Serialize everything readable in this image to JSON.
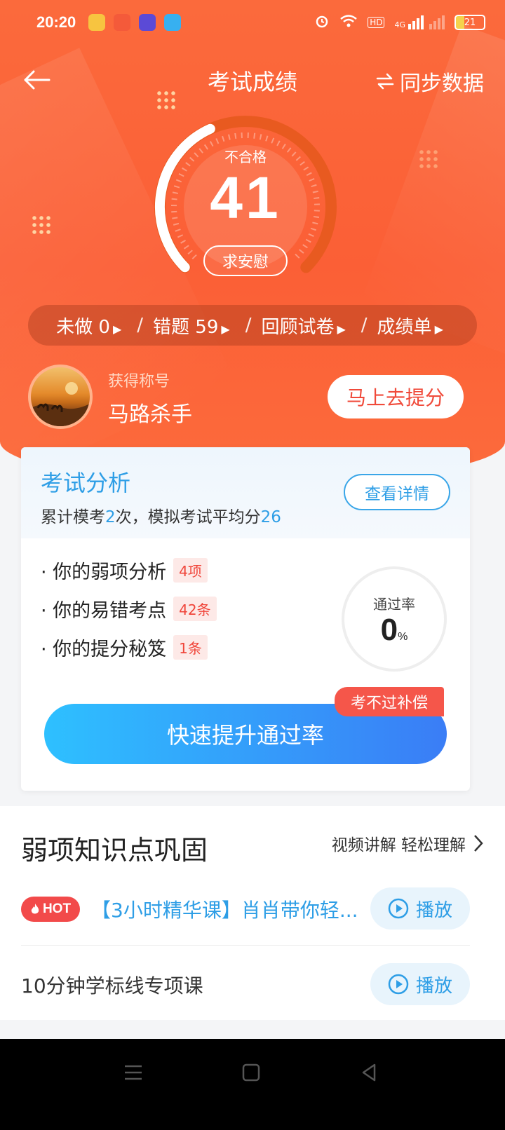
{
  "status_bar": {
    "time": "20:20",
    "battery": "21",
    "network": "4G",
    "hd_label": "HD",
    "app_icon_colors": [
      "#f7c440",
      "#f45a3a",
      "#5b4ad6",
      "#37b0f0"
    ]
  },
  "nav": {
    "title": "考试成绩",
    "sync_label": "同步数据"
  },
  "gauge": {
    "status": "不合格",
    "score": "41",
    "score_max": 100,
    "comfort_label": "求安慰"
  },
  "stats": {
    "undone": "未做 0",
    "wrong": "错题  59",
    "review": "回顾试卷",
    "report": "成绩单"
  },
  "profile": {
    "title_label": "获得称号",
    "title_value": "马路杀手",
    "boost_label": "马上去提分"
  },
  "analysis": {
    "title": "考试分析",
    "detail_label": "查看详情",
    "summary_prefix": "累计模考",
    "exam_count": "2",
    "summary_mid": "次，模拟考试平均分",
    "avg_score": "26",
    "items": [
      {
        "label": "· 你的弱项分析",
        "tag": "4项"
      },
      {
        "label": "· 你的易错考点",
        "tag": "42条"
      },
      {
        "label": "· 你的提分秘笈",
        "tag": "1条"
      }
    ],
    "pass_label": "通过率",
    "pass_value": "0",
    "pass_unit": "%",
    "fast_label": "快速提升通过率",
    "comp_tag": "考不过补偿"
  },
  "weak": {
    "title": "弱项知识点巩固",
    "more_label": "视频讲解 轻松理解",
    "courses": [
      {
        "hot": "HOT",
        "title": "【3小时精华课】肖肖带你轻...",
        "play": "播放"
      },
      {
        "title": "10分钟学标线专项课",
        "play": "播放"
      }
    ]
  }
}
